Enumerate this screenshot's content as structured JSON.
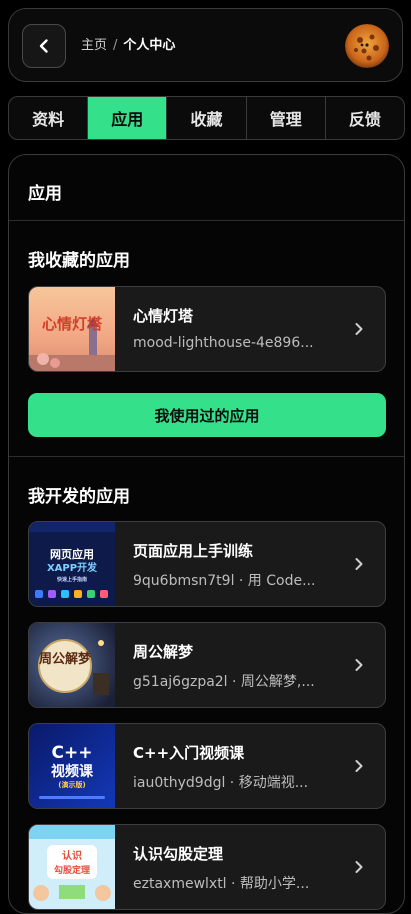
{
  "header": {
    "breadcrumb_home": "主页",
    "breadcrumb_separator": "/",
    "breadcrumb_current": "个人中心"
  },
  "tabs": [
    {
      "label": "资料",
      "active": false
    },
    {
      "label": "应用",
      "active": true
    },
    {
      "label": "收藏",
      "active": false
    },
    {
      "label": "管理",
      "active": false
    },
    {
      "label": "反馈",
      "active": false
    }
  ],
  "panel": {
    "title": "应用",
    "favorites": {
      "title": "我收藏的应用",
      "items": [
        {
          "name": "心情灯塔",
          "sub": "mood-lighthouse-4e896...",
          "thumb_text": "心情灯塔"
        }
      ]
    },
    "used_apps_button": "我使用过的应用",
    "developed": {
      "title": "我开发的应用",
      "items": [
        {
          "name": "页面应用上手训练",
          "sub": "9qu6bmsn7t9l · 用 Code...",
          "thumb_line1": "网页应用",
          "thumb_line2": "XAPP开发",
          "thumb_line3": "快速上手指南"
        },
        {
          "name": "周公解梦",
          "sub": "g51aj6gzpa2l · 周公解梦,...",
          "thumb_text": "周公解梦"
        },
        {
          "name": "C++入门视频课",
          "sub": "iau0thyd9dgl · 移动端视...",
          "thumb_line1": "C++",
          "thumb_line2": "视频课",
          "thumb_line3": "(演示版)"
        },
        {
          "name": "认识勾股定理",
          "sub": "eztaxmewlxtl · 帮助小学...",
          "thumb_line1": "认识",
          "thumb_line2": "勾股定理"
        }
      ]
    }
  },
  "colors": {
    "accent": "#34e08a",
    "card_bg": "#1a1a1a",
    "border": "#3a3a3a"
  }
}
